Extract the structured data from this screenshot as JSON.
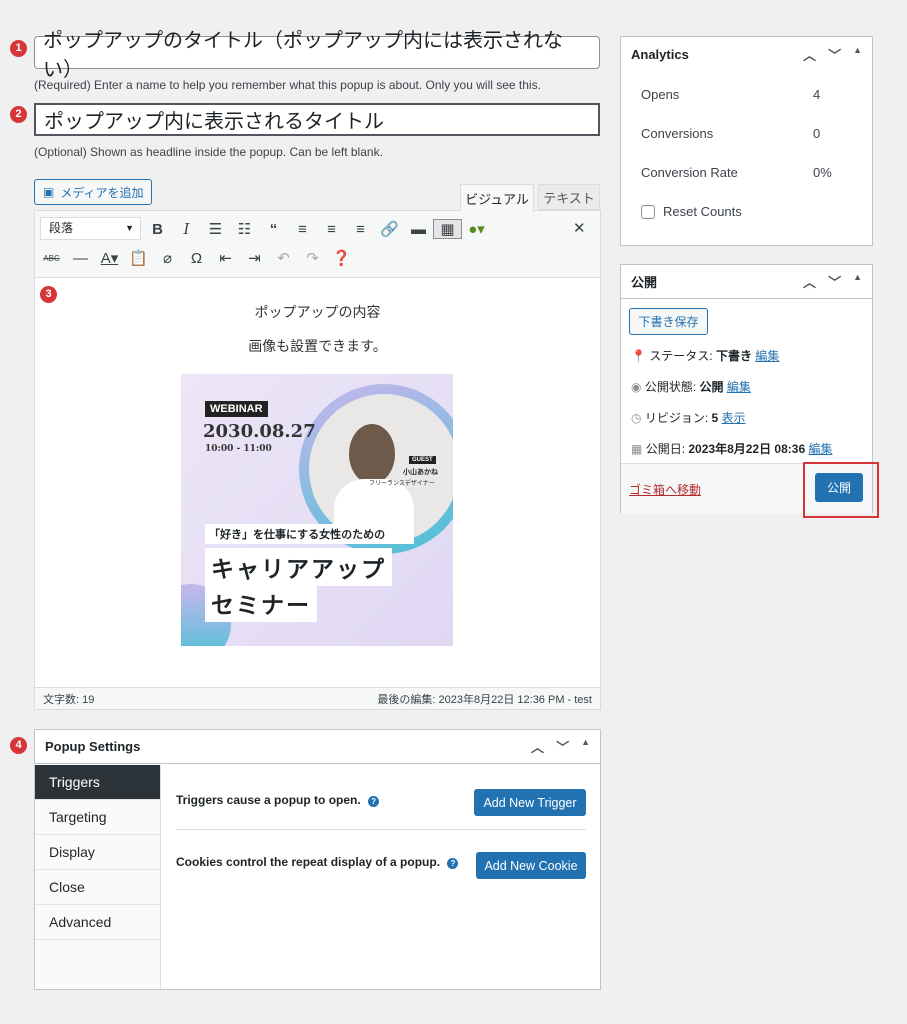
{
  "title_field": {
    "value": "ポップアップのタイトル（ポップアップ内には表示されない）",
    "help": "(Required) Enter a name to help you remember what this popup is about. Only you will see this."
  },
  "headline_field": {
    "value": "ポップアップ内に表示されるタイトル",
    "help": "(Optional) Shown as headline inside the popup. Can be left blank."
  },
  "badges": [
    "1",
    "2",
    "3",
    "4"
  ],
  "editor": {
    "add_media": "メディアを追加",
    "tabs": [
      "ビジュアル",
      "テキスト"
    ],
    "format": "段落",
    "content": [
      "ポップアップの内容",
      "画像も設置できます。"
    ],
    "image": {
      "tag": "WEBINAR",
      "date": "2030.08.27",
      "time": "10:00 - 11:00",
      "guest": "GUEST",
      "guest_name": "小山あかね",
      "guest_role": "フリーランスデザイナー",
      "sub": "「好き」を仕事にする女性のための",
      "main1": "キャリアアップ",
      "main2": "セミナー"
    },
    "word_count": "文字数: 19",
    "last_edit": "最後の編集: 2023年8月22日 12:36 PM - test"
  },
  "analytics": {
    "title": "Analytics",
    "rows": [
      {
        "label": "Opens",
        "value": "4"
      },
      {
        "label": "Conversions",
        "value": "0"
      },
      {
        "label": "Conversion Rate",
        "value": "0%"
      }
    ],
    "reset": "Reset Counts"
  },
  "publish": {
    "title": "公開",
    "save_draft": "下書き保存",
    "status_label": "ステータス:",
    "status": "下書き",
    "visibility_label": "公開状態:",
    "visibility": "公開",
    "revisions_label": "リビジョン:",
    "revisions": "5",
    "revisions_link": "表示",
    "date_label": "公開日:",
    "date": "2023年8月22日 08:36",
    "edit": "編集",
    "trash": "ゴミ箱へ移動",
    "publish_btn": "公開",
    "highlight_color": "#d63638"
  },
  "popup_settings": {
    "title": "Popup Settings",
    "tabs": [
      "Triggers",
      "Targeting",
      "Display",
      "Close",
      "Advanced"
    ],
    "triggers_text": "Triggers cause a popup to open.",
    "add_trigger": "Add New Trigger",
    "cookies_text": "Cookies control the repeat display of a popup.",
    "add_cookie": "Add New Cookie"
  }
}
